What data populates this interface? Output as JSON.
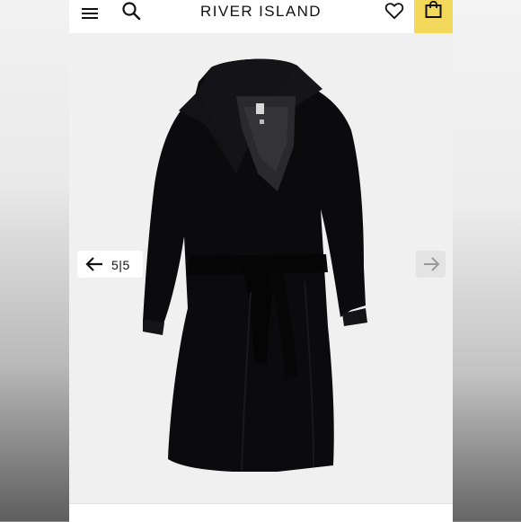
{
  "header": {
    "brand": "RIVER ISLAND",
    "menu_icon": "hamburger-menu-icon",
    "search_icon": "search-icon",
    "wishlist_icon": "heart-icon",
    "bag_icon": "shopping-bag-icon",
    "accent_color": "#f4d85b"
  },
  "gallery": {
    "current": "5",
    "separator": "|",
    "total": "5",
    "prev_icon": "arrow-left-icon",
    "next_icon": "arrow-right-icon",
    "product_image": "black belted wrap coat"
  }
}
